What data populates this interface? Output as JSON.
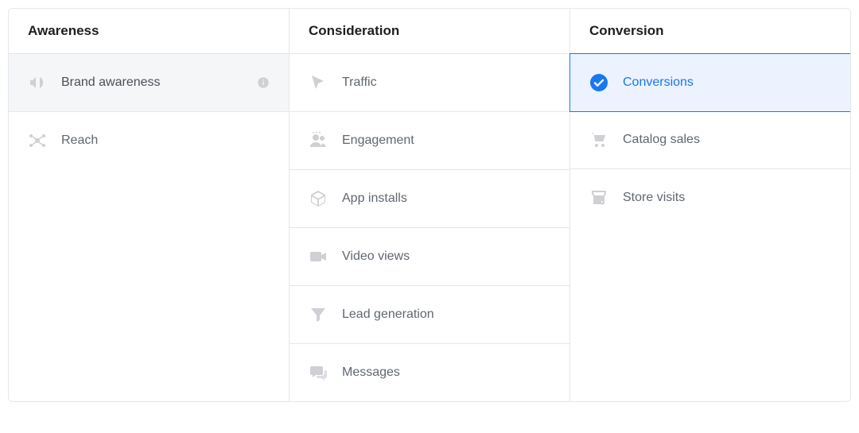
{
  "columns": {
    "awareness": {
      "title": "Awareness",
      "items": [
        {
          "label": "Brand awareness",
          "icon": "megaphone"
        },
        {
          "label": "Reach",
          "icon": "network"
        }
      ]
    },
    "consideration": {
      "title": "Consideration",
      "items": [
        {
          "label": "Traffic",
          "icon": "cursor"
        },
        {
          "label": "Engagement",
          "icon": "people"
        },
        {
          "label": "App installs",
          "icon": "box"
        },
        {
          "label": "Video views",
          "icon": "video"
        },
        {
          "label": "Lead generation",
          "icon": "funnel"
        },
        {
          "label": "Messages",
          "icon": "chat"
        }
      ]
    },
    "conversion": {
      "title": "Conversion",
      "items": [
        {
          "label": "Conversions",
          "icon": "check"
        },
        {
          "label": "Catalog sales",
          "icon": "cart"
        },
        {
          "label": "Store visits",
          "icon": "store"
        }
      ]
    }
  },
  "state": {
    "hovered": "Brand awareness",
    "selected": "Conversions"
  },
  "colors": {
    "accent": "#1877f2",
    "icon_muted": "#ced0d4",
    "text": "#606770",
    "border": "#e5e7eb",
    "hover_bg": "#f5f6f7",
    "selected_bg": "#ecf3ff"
  }
}
